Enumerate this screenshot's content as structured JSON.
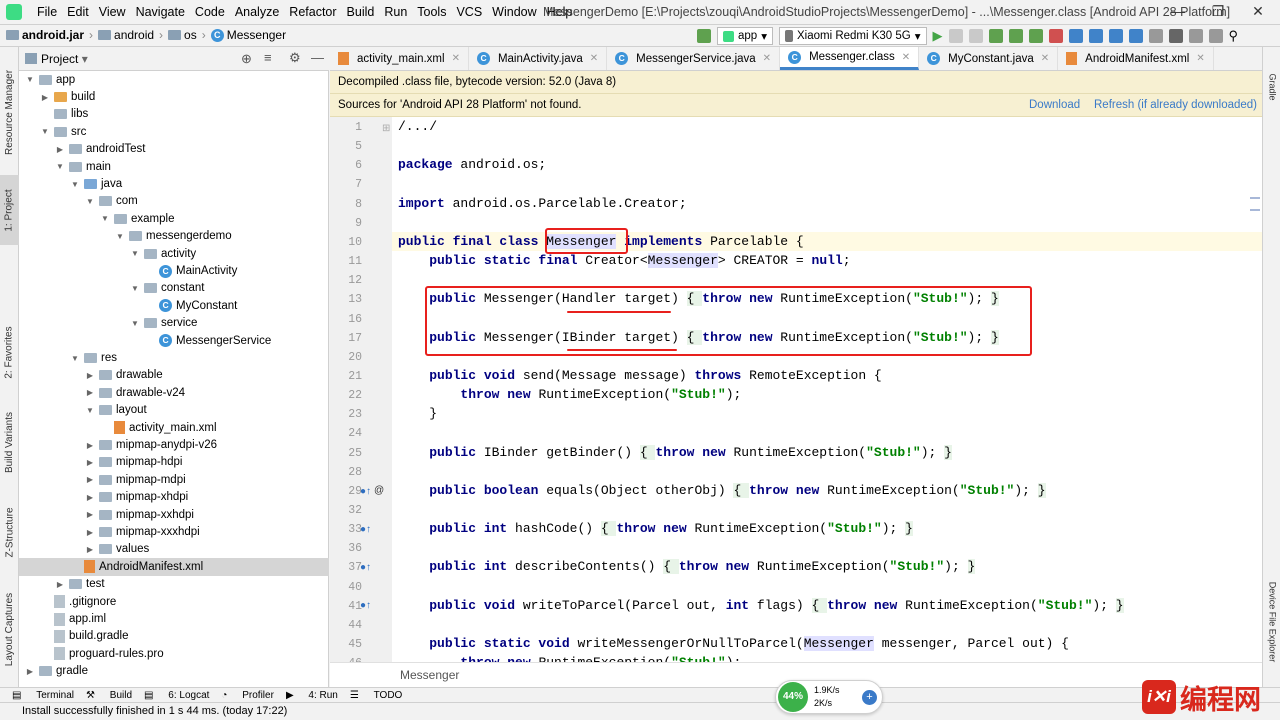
{
  "menubar": {
    "items": [
      "File",
      "Edit",
      "View",
      "Navigate",
      "Code",
      "Analyze",
      "Refactor",
      "Build",
      "Run",
      "Tools",
      "VCS",
      "Window",
      "Help"
    ],
    "title": "MessengerDemo [E:\\Projects\\zouqi\\AndroidStudioProjects\\MessengerDemo] - ...\\Messenger.class [Android API 28 Platform]"
  },
  "navbar": {
    "crumbs": [
      "android.jar",
      "android",
      "os",
      "Messenger"
    ],
    "run_config": "app",
    "device": "Xiaomi Redmi K30 5G"
  },
  "left_tabs": [
    "Resource Manager",
    "1: Project",
    "2: Favorites",
    "Build Variants",
    "Z-Structure",
    "Layout Captures"
  ],
  "right_tabs": [
    "Gradle",
    "Device File Explorer"
  ],
  "project": {
    "header": "Project",
    "tree": [
      {
        "label": "app",
        "depth": 1,
        "arrow": "▼",
        "icon": "folder"
      },
      {
        "label": "build",
        "depth": 2,
        "arrow": "▶",
        "icon": "folder-orange"
      },
      {
        "label": "libs",
        "depth": 2,
        "arrow": "",
        "icon": "folder"
      },
      {
        "label": "src",
        "depth": 2,
        "arrow": "▼",
        "icon": "folder"
      },
      {
        "label": "androidTest",
        "depth": 3,
        "arrow": "▶",
        "icon": "folder"
      },
      {
        "label": "main",
        "depth": 3,
        "arrow": "▼",
        "icon": "folder"
      },
      {
        "label": "java",
        "depth": 4,
        "arrow": "▼",
        "icon": "folder-blue"
      },
      {
        "label": "com",
        "depth": 5,
        "arrow": "▼",
        "icon": "folder"
      },
      {
        "label": "example",
        "depth": 6,
        "arrow": "▼",
        "icon": "folder"
      },
      {
        "label": "messengerdemo",
        "depth": 7,
        "arrow": "▼",
        "icon": "folder"
      },
      {
        "label": "activity",
        "depth": 8,
        "arrow": "▼",
        "icon": "folder"
      },
      {
        "label": "MainActivity",
        "depth": 9,
        "arrow": "",
        "icon": "class"
      },
      {
        "label": "constant",
        "depth": 8,
        "arrow": "▼",
        "icon": "folder"
      },
      {
        "label": "MyConstant",
        "depth": 9,
        "arrow": "",
        "icon": "class"
      },
      {
        "label": "service",
        "depth": 8,
        "arrow": "▼",
        "icon": "folder"
      },
      {
        "label": "MessengerService",
        "depth": 9,
        "arrow": "",
        "icon": "class"
      },
      {
        "label": "res",
        "depth": 4,
        "arrow": "▼",
        "icon": "folder"
      },
      {
        "label": "drawable",
        "depth": 5,
        "arrow": "▶",
        "icon": "folder"
      },
      {
        "label": "drawable-v24",
        "depth": 5,
        "arrow": "▶",
        "icon": "folder"
      },
      {
        "label": "layout",
        "depth": 5,
        "arrow": "▼",
        "icon": "folder"
      },
      {
        "label": "activity_main.xml",
        "depth": 6,
        "arrow": "",
        "icon": "xml"
      },
      {
        "label": "mipmap-anydpi-v26",
        "depth": 5,
        "arrow": "▶",
        "icon": "folder"
      },
      {
        "label": "mipmap-hdpi",
        "depth": 5,
        "arrow": "▶",
        "icon": "folder"
      },
      {
        "label": "mipmap-mdpi",
        "depth": 5,
        "arrow": "▶",
        "icon": "folder"
      },
      {
        "label": "mipmap-xhdpi",
        "depth": 5,
        "arrow": "▶",
        "icon": "folder"
      },
      {
        "label": "mipmap-xxhdpi",
        "depth": 5,
        "arrow": "▶",
        "icon": "folder"
      },
      {
        "label": "mipmap-xxxhdpi",
        "depth": 5,
        "arrow": "▶",
        "icon": "folder"
      },
      {
        "label": "values",
        "depth": 5,
        "arrow": "▶",
        "icon": "folder"
      },
      {
        "label": "AndroidManifest.xml",
        "depth": 4,
        "arrow": "",
        "icon": "xml",
        "selected": true
      },
      {
        "label": "test",
        "depth": 3,
        "arrow": "▶",
        "icon": "folder"
      },
      {
        "label": ".gitignore",
        "depth": 2,
        "arrow": "",
        "icon": "file"
      },
      {
        "label": "app.iml",
        "depth": 2,
        "arrow": "",
        "icon": "file"
      },
      {
        "label": "build.gradle",
        "depth": 2,
        "arrow": "",
        "icon": "file"
      },
      {
        "label": "proguard-rules.pro",
        "depth": 2,
        "arrow": "",
        "icon": "file"
      },
      {
        "label": "gradle",
        "depth": 1,
        "arrow": "▶",
        "icon": "folder"
      }
    ]
  },
  "tabs": [
    {
      "label": "activity_main.xml",
      "icon": "xml"
    },
    {
      "label": "MainActivity.java",
      "icon": "class"
    },
    {
      "label": "MessengerService.java",
      "icon": "class"
    },
    {
      "label": "Messenger.class",
      "icon": "class",
      "active": true
    },
    {
      "label": "MyConstant.java",
      "icon": "class"
    },
    {
      "label": "AndroidManifest.xml",
      "icon": "xml"
    }
  ],
  "banner1": "Decompiled .class file, bytecode version: 52.0 (Java 8)",
  "banner2": {
    "text": "Sources for 'Android API 28 Platform' not found.",
    "download": "Download",
    "refresh": "Refresh (if already downloaded)"
  },
  "code": [
    {
      "n": "1",
      "parts": [
        [
          "",
          "/.../"
        ]
      ]
    },
    {
      "n": "5",
      "parts": []
    },
    {
      "n": "6",
      "parts": [
        [
          "kw",
          "package"
        ],
        [
          "",
          " android.os;"
        ]
      ]
    },
    {
      "n": "7",
      "parts": []
    },
    {
      "n": "8",
      "parts": [
        [
          "kw",
          "import"
        ],
        [
          "",
          " android.os.Parcelable.Creator;"
        ]
      ]
    },
    {
      "n": "9",
      "parts": []
    },
    {
      "n": "10",
      "parts": [
        [
          "kw",
          "public final class "
        ],
        [
          "hl",
          "Messenger"
        ],
        [
          "kw",
          " implements"
        ],
        [
          "",
          " Parcelable {"
        ]
      ]
    },
    {
      "n": "11",
      "parts": [
        [
          "",
          "    "
        ],
        [
          "kw",
          "public static final"
        ],
        [
          "",
          " Creator<"
        ],
        [
          "hl",
          "Messenger"
        ],
        [
          "",
          "> CREATOR = "
        ],
        [
          "kw",
          "null"
        ],
        [
          "",
          ";"
        ]
      ]
    },
    {
      "n": "12",
      "parts": []
    },
    {
      "n": "13",
      "parts": [
        [
          "",
          "    "
        ],
        [
          "kw",
          "public"
        ],
        [
          "",
          " Messenger(Handler target) "
        ],
        [
          "brc",
          "{ "
        ],
        [
          "kw",
          "throw new"
        ],
        [
          "",
          " RuntimeException("
        ],
        [
          "str",
          "\"Stub!\""
        ],
        [
          "",
          "); "
        ],
        [
          "brc",
          "}"
        ]
      ]
    },
    {
      "n": "16",
      "parts": []
    },
    {
      "n": "17",
      "parts": [
        [
          "",
          "    "
        ],
        [
          "kw",
          "public"
        ],
        [
          "",
          " Messenger(IBinder target) "
        ],
        [
          "brc",
          "{ "
        ],
        [
          "kw",
          "throw new"
        ],
        [
          "",
          " RuntimeException("
        ],
        [
          "str",
          "\"Stub!\""
        ],
        [
          "",
          "); "
        ],
        [
          "brc",
          "}"
        ]
      ]
    },
    {
      "n": "20",
      "parts": []
    },
    {
      "n": "21",
      "parts": [
        [
          "",
          "    "
        ],
        [
          "kw",
          "public void"
        ],
        [
          "",
          " send(Message message) "
        ],
        [
          "kw",
          "throws"
        ],
        [
          "",
          " RemoteException {"
        ]
      ]
    },
    {
      "n": "22",
      "parts": [
        [
          "",
          "        "
        ],
        [
          "kw",
          "throw new"
        ],
        [
          "",
          " RuntimeException("
        ],
        [
          "str",
          "\"Stub!\""
        ],
        [
          "",
          ");"
        ]
      ]
    },
    {
      "n": "23",
      "parts": [
        [
          "",
          "    }"
        ]
      ]
    },
    {
      "n": "24",
      "parts": []
    },
    {
      "n": "25",
      "parts": [
        [
          "",
          "    "
        ],
        [
          "kw",
          "public"
        ],
        [
          "",
          " IBinder getBinder() "
        ],
        [
          "brc",
          "{ "
        ],
        [
          "kw",
          "throw new"
        ],
        [
          "",
          " RuntimeException("
        ],
        [
          "str",
          "\"Stub!\""
        ],
        [
          "",
          "); "
        ],
        [
          "brc",
          "}"
        ]
      ]
    },
    {
      "n": "28",
      "parts": []
    },
    {
      "n": "29",
      "parts": [
        [
          "",
          "    "
        ],
        [
          "kw",
          "public boolean"
        ],
        [
          "",
          " equals(Object otherObj) "
        ],
        [
          "brc",
          "{ "
        ],
        [
          "kw",
          "throw new"
        ],
        [
          "",
          " RuntimeException("
        ],
        [
          "str",
          "\"Stub!\""
        ],
        [
          "",
          "); "
        ],
        [
          "brc",
          "}"
        ]
      ]
    },
    {
      "n": "32",
      "parts": []
    },
    {
      "n": "33",
      "parts": [
        [
          "",
          "    "
        ],
        [
          "kw",
          "public int"
        ],
        [
          "",
          " hashCode() "
        ],
        [
          "brc",
          "{ "
        ],
        [
          "kw",
          "throw new"
        ],
        [
          "",
          " RuntimeException("
        ],
        [
          "str",
          "\"Stub!\""
        ],
        [
          "",
          "); "
        ],
        [
          "brc",
          "}"
        ]
      ]
    },
    {
      "n": "36",
      "parts": []
    },
    {
      "n": "37",
      "parts": [
        [
          "",
          "    "
        ],
        [
          "kw",
          "public int"
        ],
        [
          "",
          " describeContents() "
        ],
        [
          "brc",
          "{ "
        ],
        [
          "kw",
          "throw new"
        ],
        [
          "",
          " RuntimeException("
        ],
        [
          "str",
          "\"Stub!\""
        ],
        [
          "",
          "); "
        ],
        [
          "brc",
          "}"
        ]
      ]
    },
    {
      "n": "40",
      "parts": []
    },
    {
      "n": "41",
      "parts": [
        [
          "",
          "    "
        ],
        [
          "kw",
          "public void"
        ],
        [
          "",
          " writeToParcel(Parcel out, "
        ],
        [
          "kw",
          "int"
        ],
        [
          "",
          " flags) "
        ],
        [
          "brc",
          "{ "
        ],
        [
          "kw",
          "throw new"
        ],
        [
          "",
          " RuntimeException("
        ],
        [
          "str",
          "\"Stub!\""
        ],
        [
          "",
          "); "
        ],
        [
          "brc",
          "}"
        ]
      ]
    },
    {
      "n": "44",
      "parts": []
    },
    {
      "n": "45",
      "parts": [
        [
          "",
          "    "
        ],
        [
          "kw",
          "public static void"
        ],
        [
          "",
          " writeMessengerOrNullToParcel("
        ],
        [
          "hl",
          "Messenger"
        ],
        [
          "",
          " messenger, Parcel out) {"
        ]
      ]
    },
    {
      "n": "46",
      "parts": [
        [
          "",
          "        "
        ],
        [
          "kw",
          "throw new"
        ],
        [
          "",
          " RuntimeException("
        ],
        [
          "str",
          "\"Stub!\""
        ],
        [
          "",
          ");"
        ]
      ]
    }
  ],
  "editor_footer": "Messenger",
  "bottom_tools": [
    "Terminal",
    "Build",
    "6: Logcat",
    "Profiler",
    "4: Run",
    "TODO"
  ],
  "status": "Install successfully finished in 1 s 44 ms. (today 17:22)",
  "network": {
    "percent": "44%",
    "up": "1.9K/s",
    "down": "2K/s"
  },
  "watermark": {
    "logo": "i✕i",
    "text": "编程网"
  },
  "colors": {
    "keyword": "#000080",
    "string": "#008000",
    "annotation": "#e8201d",
    "banner": "#f7f0d2",
    "accent": "#4083c9"
  }
}
